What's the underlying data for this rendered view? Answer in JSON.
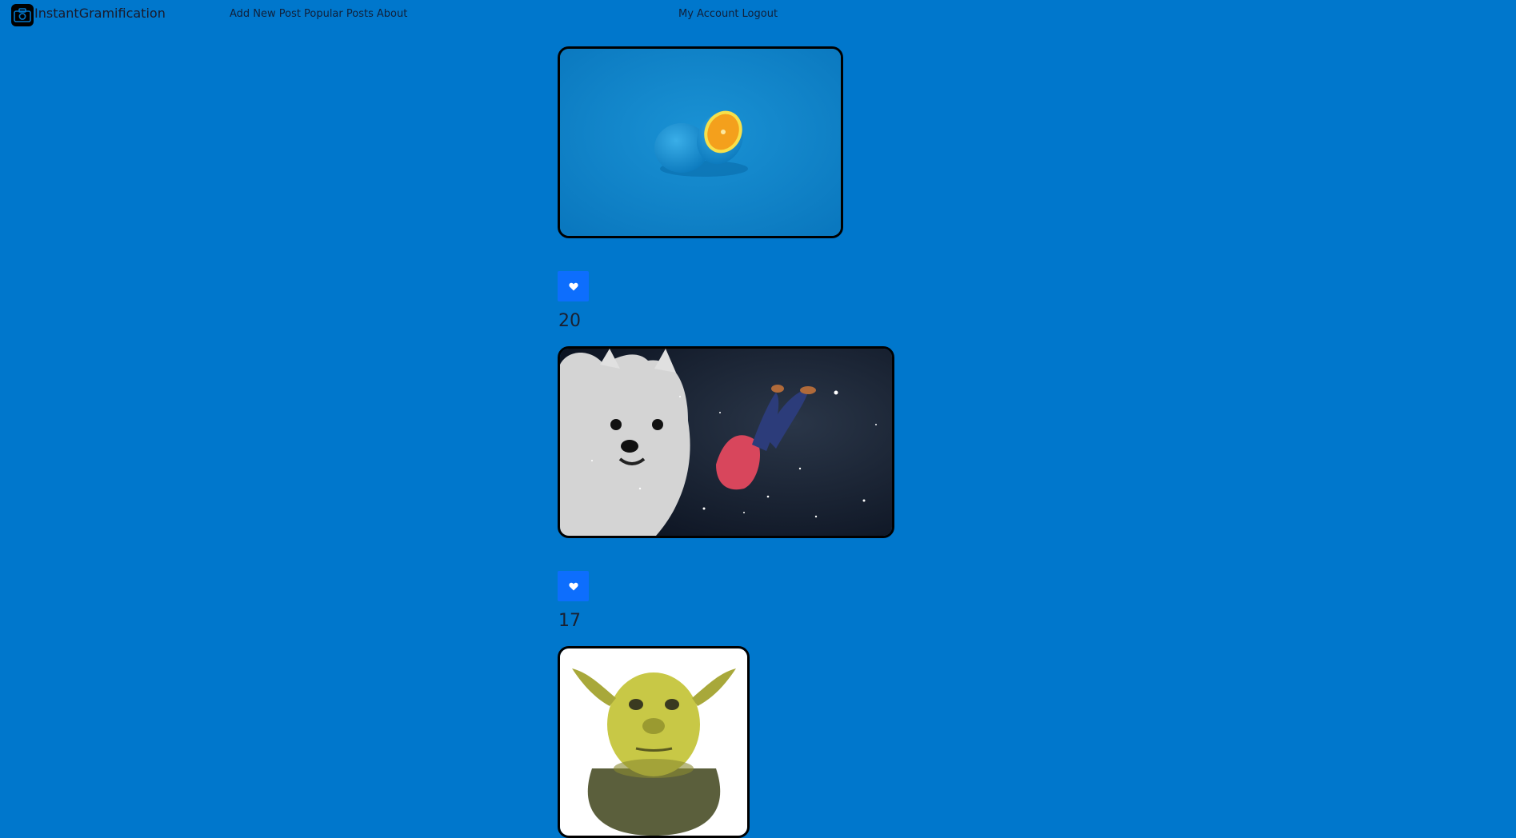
{
  "header": {
    "brand_name": "InstantGramification",
    "brand_icon": "camera-icon",
    "nav_left": [
      {
        "label": "Add New Post"
      },
      {
        "label": "Popular Posts"
      },
      {
        "label": "About"
      }
    ],
    "nav_right": [
      {
        "label": "My Account"
      },
      {
        "label": "Logout"
      }
    ]
  },
  "colors": {
    "page_background": "#0077cc",
    "like_button": "#0d6efd",
    "image_border": "#000000"
  },
  "posts": [
    {
      "image_subject": "blue orange cut open on blue background",
      "likes": "20",
      "like_icon": "heart-icon"
    },
    {
      "image_subject": "white fluffy dog and falling man in starry space",
      "likes": "17",
      "like_icon": "heart-icon"
    },
    {
      "image_subject": "green ogre face close-up",
      "likes": "",
      "like_icon": "heart-icon"
    }
  ]
}
